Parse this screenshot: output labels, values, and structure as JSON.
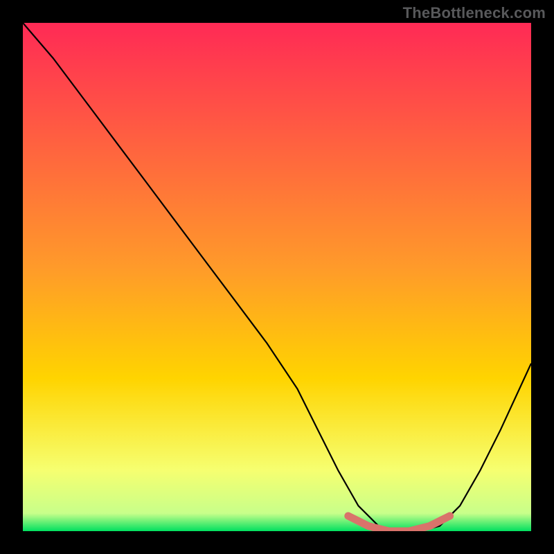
{
  "watermark": "TheBottleneck.com",
  "colors": {
    "background": "#000000",
    "grad_top": "#ff2a55",
    "grad_mid": "#ffd400",
    "grad_low": "#f6ff70",
    "grad_bottom": "#00e060",
    "curve": "#000000",
    "highlight": "#d9736b"
  },
  "chart_data": {
    "type": "line",
    "title": "",
    "xlabel": "",
    "ylabel": "",
    "xlim": [
      0,
      100
    ],
    "ylim": [
      0,
      100
    ],
    "series": [
      {
        "name": "bottleneck-curve",
        "x": [
          0,
          6,
          12,
          18,
          24,
          30,
          36,
          42,
          48,
          54,
          58,
          62,
          66,
          70,
          74,
          78,
          82,
          86,
          90,
          94,
          100
        ],
        "y": [
          100,
          93,
          85,
          77,
          69,
          61,
          53,
          45,
          37,
          28,
          20,
          12,
          5,
          1,
          0,
          0,
          1,
          5,
          12,
          20,
          33
        ]
      }
    ],
    "highlight": {
      "name": "optimal-range",
      "x": [
        64,
        68,
        72,
        76,
        80,
        84
      ],
      "y": [
        3,
        1,
        0,
        0,
        1,
        3
      ]
    }
  }
}
